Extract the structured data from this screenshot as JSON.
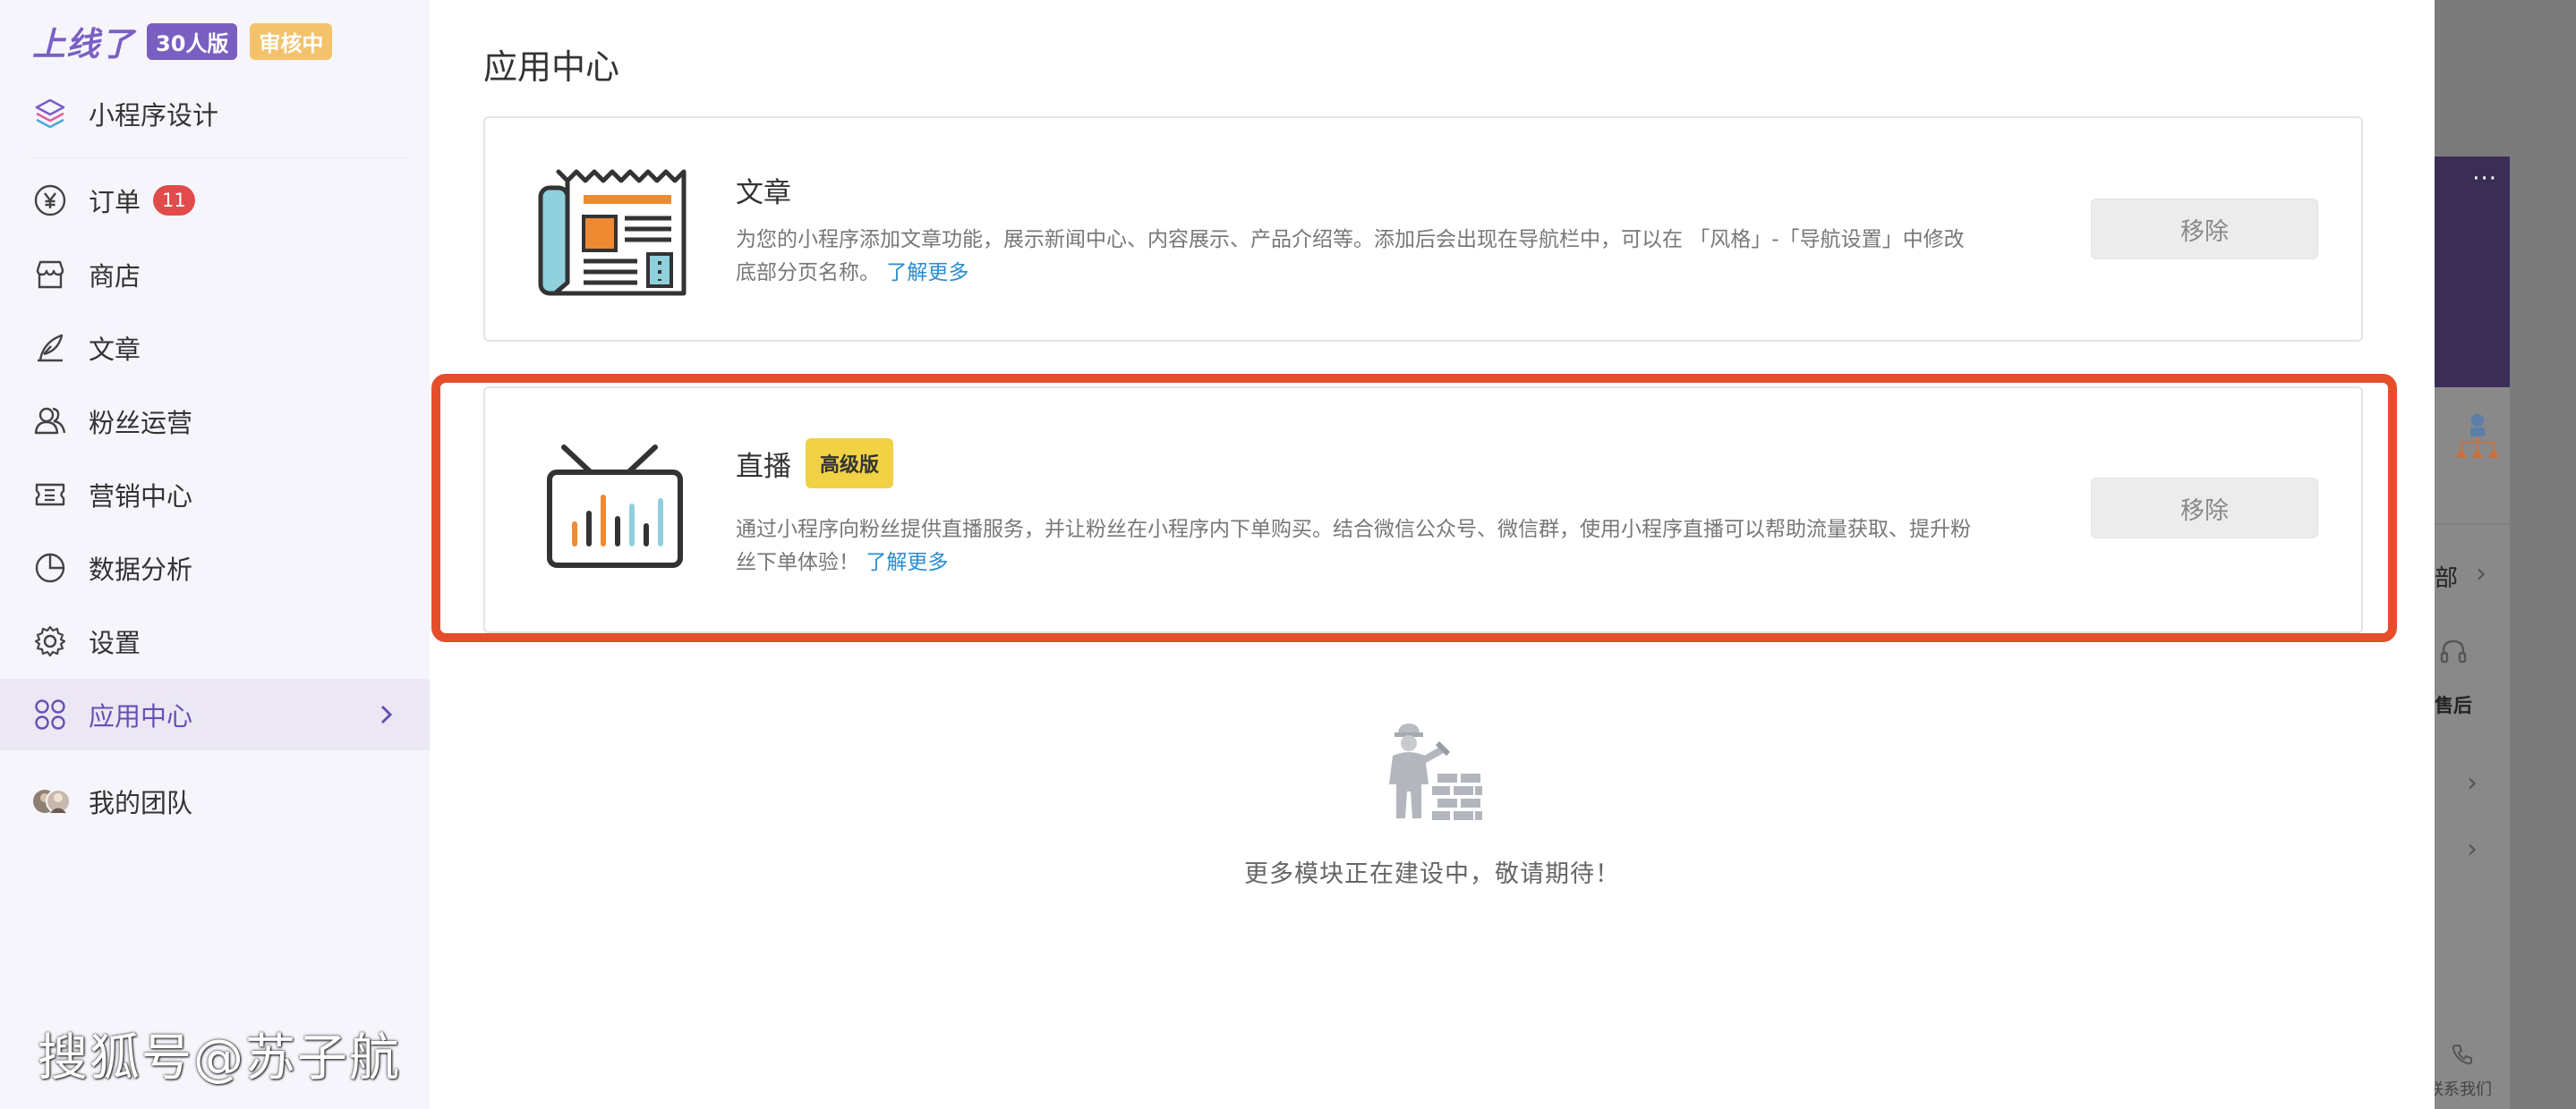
{
  "sidebar": {
    "brand": "上线了",
    "plan_badge": "30人版",
    "status_badge": "审核中",
    "design_label": "小程序设计",
    "items": [
      {
        "label": "订单",
        "badge": "11"
      },
      {
        "label": "商店"
      },
      {
        "label": "文章"
      },
      {
        "label": "粉丝运营"
      },
      {
        "label": "营销中心"
      },
      {
        "label": "数据分析"
      },
      {
        "label": "设置"
      },
      {
        "label": "应用中心"
      }
    ],
    "team_label": "我的团队"
  },
  "main": {
    "title": "应用中心",
    "apps": [
      {
        "name": "文章",
        "description": "为您的小程序添加文章功能，展示新闻中心、内容展示、产品介绍等。添加后会出现在导航栏中，可以在 「风格」-「导航设置」中修改底部分页名称。",
        "learn_more": "了解更多",
        "remove_label": "移除"
      },
      {
        "name": "直播",
        "badge": "高级版",
        "description": "通过小程序向粉丝提供直播服务，并让粉丝在小程序内下单购买。结合微信公众号、微信群，使用小程序直播可以帮助流量获取、提升粉丝下单体验！",
        "learn_more": "了解更多",
        "remove_label": "移除"
      }
    ],
    "coming_soon": "更多模块正在建设中，敬请期待！"
  },
  "watermark": "搜狐号@苏子航",
  "right_panel": {
    "menu_dots": "···",
    "text_all": "部",
    "text_after_sale": "售后",
    "text_contact": "联系我们"
  },
  "colors": {
    "accent_purple": "#7a5fc3",
    "badge_red": "#e24b4b",
    "highlight_border": "#e44e2a",
    "pro_badge": "#f0d244",
    "link": "#2a8ccf"
  }
}
